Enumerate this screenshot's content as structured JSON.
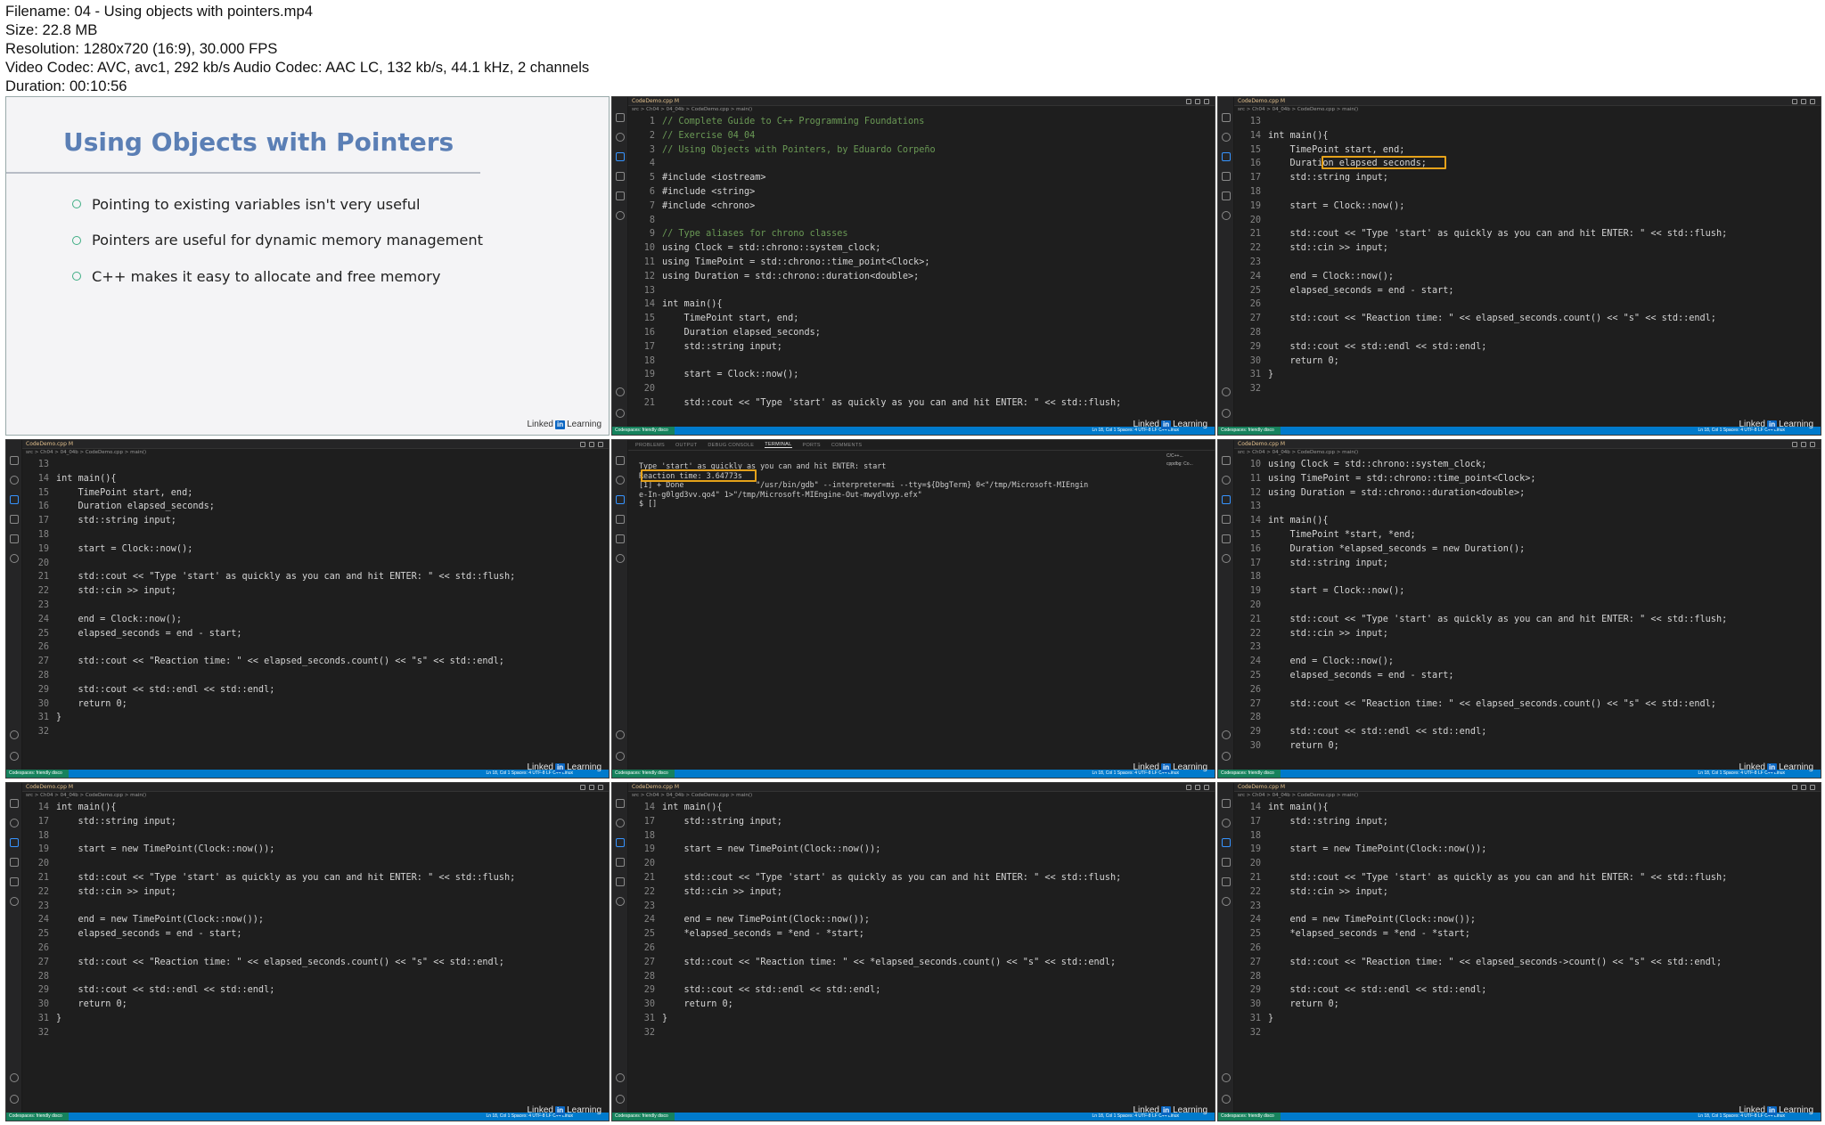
{
  "info": {
    "filename": "Filename: 04 - Using objects with pointers.mp4",
    "size": "Size: 22.8 MB",
    "resolution": "Resolution: 1280x720 (16:9), 30.000 FPS",
    "codec": "Video Codec: AVC, avc1, 292 kb/s Audio Codec: AAC LC, 132 kb/s, 44.1 kHz, 2 channels",
    "duration": "Duration: 00:10:56"
  },
  "watermark": {
    "brand": "Linked",
    "in": "in",
    "suffix": "Learning"
  },
  "slide": {
    "title": "Using Objects with Pointers",
    "bullets": [
      "Pointing to existing variables isn't very useful",
      "Pointers are useful for dynamic memory management",
      "C++ makes it easy to allocate and free memory"
    ]
  },
  "editor": {
    "tab_label": "CodeDemo.cpp M",
    "crumbs": "src > Ch04 > 04_04b > CodeDemo.cpp > main()",
    "remote": "Codespaces: friendly disco",
    "position": "Ln 18, Col 1  Spaces: 4  UTF-8  LF  C++  Linux"
  },
  "panels": [
    {
      "lines": [
        [
          "1",
          "// Complete Guide to C++ Programming Foundations",
          1
        ],
        [
          "2",
          "// Exercise 04_04",
          1
        ],
        [
          "3",
          "// Using Objects with Pointers, by Eduardo Corpeño",
          1
        ],
        [
          "4",
          "",
          0
        ],
        [
          "5",
          "#include <iostream>",
          0
        ],
        [
          "6",
          "#include <string>",
          0
        ],
        [
          "7",
          "#include <chrono>",
          0
        ],
        [
          "8",
          "",
          0
        ],
        [
          "9",
          "// Type aliases for chrono classes",
          1
        ],
        [
          "10",
          "using Clock = std::chrono::system_clock;",
          0
        ],
        [
          "11",
          "using TimePoint = std::chrono::time_point<Clock>;",
          0
        ],
        [
          "12",
          "using Duration = std::chrono::duration<double>;",
          0
        ],
        [
          "13",
          "",
          0
        ],
        [
          "14",
          "int main(){",
          0
        ],
        [
          "15",
          "    TimePoint start, end;",
          0
        ],
        [
          "16",
          "    Duration elapsed_seconds;",
          0
        ],
        [
          "17",
          "    std::string input;",
          0
        ],
        [
          "18",
          "",
          0
        ],
        [
          "19",
          "    start = Clock::now();",
          0
        ],
        [
          "20",
          "",
          0
        ],
        [
          "21",
          "    std::cout << \"Type 'start' as quickly as you can and hit ENTER: \" << std::flush;",
          0
        ]
      ]
    },
    {
      "lines": [
        [
          "13",
          "",
          0
        ],
        [
          "14",
          "int main(){",
          0
        ],
        [
          "15",
          "    TimePoint start, end;",
          0
        ],
        [
          "16",
          "    Duration elapsed_seconds;",
          0
        ],
        [
          "17",
          "    std::string input;",
          0
        ],
        [
          "18",
          "",
          0
        ],
        [
          "19",
          "    start = Clock::now();",
          0
        ],
        [
          "20",
          "",
          0
        ],
        [
          "21",
          "    std::cout << \"Type 'start' as quickly as you can and hit ENTER: \" << std::flush;",
          0
        ],
        [
          "22",
          "    std::cin >> input;",
          0
        ],
        [
          "23",
          "",
          0
        ],
        [
          "24",
          "    end = Clock::now();",
          0
        ],
        [
          "25",
          "    elapsed_seconds = end - start;",
          0
        ],
        [
          "26",
          "",
          0
        ],
        [
          "27",
          "    std::cout << \"Reaction time: \" << elapsed_seconds.count() << \"s\" << std::endl;",
          0
        ],
        [
          "28",
          "",
          0
        ],
        [
          "29",
          "    std::cout << std::endl << std::endl;",
          0
        ],
        [
          "30",
          "    return 0;",
          0
        ],
        [
          "31",
          "}",
          0
        ],
        [
          "32",
          "",
          0
        ]
      ]
    },
    {
      "lines": [
        [
          "13",
          "",
          0
        ],
        [
          "14",
          "int main(){",
          0
        ],
        [
          "15",
          "    TimePoint start, end;",
          0
        ],
        [
          "16",
          "    Duration elapsed_seconds;",
          0
        ],
        [
          "17",
          "    std::string input;",
          0
        ],
        [
          "18",
          "",
          0
        ],
        [
          "19",
          "    start = Clock::now();",
          0
        ],
        [
          "20",
          "",
          0
        ],
        [
          "21",
          "    std::cout << \"Type 'start' as quickly as you can and hit ENTER: \" << std::flush;",
          0
        ],
        [
          "22",
          "    std::cin >> input;",
          0
        ],
        [
          "23",
          "",
          0
        ],
        [
          "24",
          "    end = Clock::now();",
          0
        ],
        [
          "25",
          "    elapsed_seconds = end - start;",
          0
        ],
        [
          "26",
          "",
          0
        ],
        [
          "27",
          "    std::cout << \"Reaction time: \" << elapsed_seconds.count() << \"s\" << std::endl;",
          0
        ],
        [
          "28",
          "",
          0
        ],
        [
          "29",
          "    std::cout << std::endl << std::endl;",
          0
        ],
        [
          "30",
          "    return 0;",
          0
        ],
        [
          "31",
          "}",
          0
        ],
        [
          "32",
          "",
          0
        ]
      ]
    },
    {
      "lines": [
        [
          "10",
          "using Clock = std::chrono::system_clock;",
          0
        ],
        [
          "11",
          "using TimePoint = std::chrono::time_point<Clock>;",
          0
        ],
        [
          "12",
          "using Duration = std::chrono::duration<double>;",
          0
        ],
        [
          "13",
          "",
          0
        ],
        [
          "14",
          "int main(){",
          0
        ],
        [
          "15",
          "    TimePoint *start, *end;",
          0
        ],
        [
          "16",
          "    Duration *elapsed_seconds = new Duration();",
          0
        ],
        [
          "17",
          "    std::string input;",
          0
        ],
        [
          "18",
          "",
          0
        ],
        [
          "19",
          "    start = Clock::now();",
          0
        ],
        [
          "20",
          "",
          0
        ],
        [
          "21",
          "    std::cout << \"Type 'start' as quickly as you can and hit ENTER: \" << std::flush;",
          0
        ],
        [
          "22",
          "    std::cin >> input;",
          0
        ],
        [
          "23",
          "",
          0
        ],
        [
          "24",
          "    end = Clock::now();",
          0
        ],
        [
          "25",
          "    elapsed_seconds = end - start;",
          0
        ],
        [
          "26",
          "",
          0
        ],
        [
          "27",
          "    std::cout << \"Reaction time: \" << elapsed_seconds.count() << \"s\" << std::endl;",
          0
        ],
        [
          "28",
          "",
          0
        ],
        [
          "29",
          "    std::cout << std::endl << std::endl;",
          0
        ],
        [
          "30",
          "    return 0;",
          0
        ]
      ]
    },
    {
      "lines": [
        [
          "14",
          "int main(){",
          0
        ],
        [
          "17",
          "    std::string input;",
          0
        ],
        [
          "18",
          "",
          0
        ],
        [
          "19",
          "    start = new TimePoint(Clock::now());",
          0
        ],
        [
          "20",
          "",
          0
        ],
        [
          "21",
          "    std::cout << \"Type 'start' as quickly as you can and hit ENTER: \" << std::flush;",
          0
        ],
        [
          "22",
          "    std::cin >> input;",
          0
        ],
        [
          "23",
          "",
          0
        ],
        [
          "24",
          "    end = new TimePoint(Clock::now());",
          0
        ],
        [
          "25",
          "    elapsed_seconds = end - start;",
          0
        ],
        [
          "26",
          "",
          0
        ],
        [
          "27",
          "    std::cout << \"Reaction time: \" << elapsed_seconds.count() << \"s\" << std::endl;",
          0
        ],
        [
          "28",
          "",
          0
        ],
        [
          "29",
          "    std::cout << std::endl << std::endl;",
          0
        ],
        [
          "30",
          "    return 0;",
          0
        ],
        [
          "31",
          "}",
          0
        ],
        [
          "32",
          "",
          0
        ]
      ]
    },
    {
      "lines": [
        [
          "14",
          "int main(){",
          0
        ],
        [
          "17",
          "    std::string input;",
          0
        ],
        [
          "18",
          "",
          0
        ],
        [
          "19",
          "    start = new TimePoint(Clock::now());",
          0
        ],
        [
          "20",
          "",
          0
        ],
        [
          "21",
          "    std::cout << \"Type 'start' as quickly as you can and hit ENTER: \" << std::flush;",
          0
        ],
        [
          "22",
          "    std::cin >> input;",
          0
        ],
        [
          "23",
          "",
          0
        ],
        [
          "24",
          "    end = new TimePoint(Clock::now());",
          0
        ],
        [
          "25",
          "    *elapsed_seconds = *end - *start;",
          0
        ],
        [
          "26",
          "",
          0
        ],
        [
          "27",
          "    std::cout << \"Reaction time: \" << *elapsed_seconds.count() << \"s\" << std::endl;",
          0
        ],
        [
          "28",
          "",
          0
        ],
        [
          "29",
          "    std::cout << std::endl << std::endl;",
          0
        ],
        [
          "30",
          "    return 0;",
          0
        ],
        [
          "31",
          "}",
          0
        ],
        [
          "32",
          "",
          0
        ]
      ]
    },
    {
      "lines": [
        [
          "14",
          "int main(){",
          0
        ],
        [
          "17",
          "    std::string input;",
          0
        ],
        [
          "18",
          "",
          0
        ],
        [
          "19",
          "    start = new TimePoint(Clock::now());",
          0
        ],
        [
          "20",
          "",
          0
        ],
        [
          "21",
          "    std::cout << \"Type 'start' as quickly as you can and hit ENTER: \" << std::flush;",
          0
        ],
        [
          "22",
          "    std::cin >> input;",
          0
        ],
        [
          "23",
          "",
          0
        ],
        [
          "24",
          "    end = new TimePoint(Clock::now());",
          0
        ],
        [
          "25",
          "    *elapsed_seconds = *end - *start;",
          0
        ],
        [
          "26",
          "",
          0
        ],
        [
          "27",
          "    std::cout << \"Reaction time: \" << elapsed_seconds->count() << \"s\" << std::endl;",
          0
        ],
        [
          "28",
          "",
          0
        ],
        [
          "29",
          "    std::cout << std::endl << std::endl;",
          0
        ],
        [
          "30",
          "    return 0;",
          0
        ],
        [
          "31",
          "}",
          0
        ],
        [
          "32",
          "",
          0
        ]
      ]
    }
  ],
  "terminal": {
    "tabs": [
      "PROBLEMS",
      "OUTPUT",
      "DEBUG CONSOLE",
      "TERMINAL",
      "PORTS",
      "COMMENTS"
    ],
    "side": [
      "C/C++...",
      "cppdbg: Co..."
    ],
    "lines": [
      "Type 'start' as quickly as you can and hit ENTER: start",
      "Reaction time: 3.64773s",
      "",
      "[1] + Done                \"/usr/bin/gdb\" --interpreter=mi --tty=${DbgTerm} 0<\"/tmp/Microsoft-MIEngin",
      "e-In-g0lgd3vv.qo4\" 1>\"/tmp/Microsoft-MIEngine-Out-mwydlvyp.efx\"",
      "$ []"
    ]
  }
}
